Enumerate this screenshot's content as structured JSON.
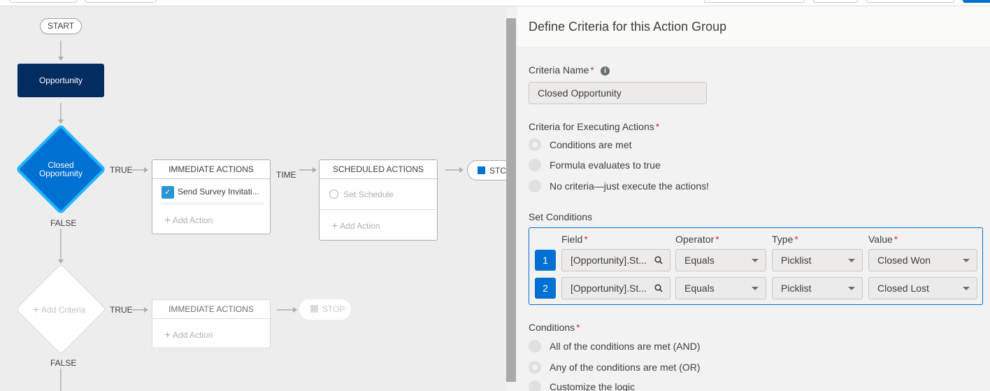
{
  "flow": {
    "start_label": "START",
    "object_label": "Opportunity",
    "criteria_1": {
      "label_line1": "Closed",
      "label_line2": "Opportunity",
      "true_label": "TRUE",
      "false_label": "FALSE"
    },
    "immediate_actions_1": {
      "header": "IMMEDIATE ACTIONS",
      "action_label": "Send Survey Invitati...",
      "add_action": "Add Action"
    },
    "time_label": "TIME",
    "scheduled_actions": {
      "header": "SCHEDULED ACTIONS",
      "set_schedule": "Set Schedule",
      "add_action": "Add Action"
    },
    "stop_1_label": "STC",
    "criteria_2": {
      "add_label": "Add Criteria",
      "true_label": "TRUE",
      "false_label": "FALSE"
    },
    "immediate_actions_2": {
      "header": "IMMEDIATE ACTIONS",
      "add_action": "Add Action"
    },
    "stop_2_label": "STOP"
  },
  "panel": {
    "title": "Define Criteria for this Action Group",
    "criteria_name_label": "Criteria Name",
    "criteria_name_value": "Closed Opportunity",
    "executing_label": "Criteria for Executing Actions",
    "executing_options": [
      {
        "label": "Conditions are met",
        "selected": true
      },
      {
        "label": "Formula evaluates to true",
        "selected": false
      },
      {
        "label": "No criteria—just execute the actions!",
        "selected": false
      }
    ],
    "set_conditions_label": "Set Conditions",
    "columns": {
      "field": "Field",
      "operator": "Operator",
      "type": "Type",
      "value": "Value"
    },
    "rows": [
      {
        "num": "1",
        "field": "[Opportunity].St...",
        "operator": "Equals",
        "type": "Picklist",
        "value": "Closed Won"
      },
      {
        "num": "2",
        "field": "[Opportunity].St...",
        "operator": "Equals",
        "type": "Picklist",
        "value": "Closed Lost"
      }
    ],
    "conditions_label": "Conditions",
    "condition_options": [
      {
        "label": "All of the conditions are met (AND)",
        "selected": false
      },
      {
        "label": "Any of the conditions are met (OR)",
        "selected": true
      },
      {
        "label": "Customize the logic",
        "selected": false
      }
    ]
  },
  "colors": {
    "navy": "#032d60",
    "brand_blue": "#0070d2",
    "diamond_glow": "#1fb6ff",
    "required": "#c23934"
  }
}
